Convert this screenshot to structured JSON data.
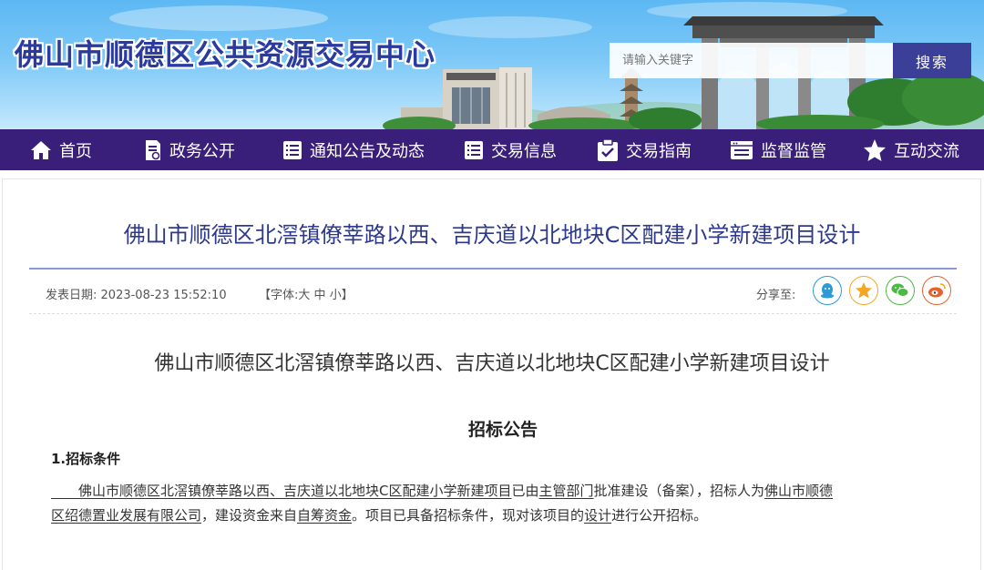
{
  "header": {
    "site_title": "佛山市顺德区公共资源交易中心",
    "search": {
      "placeholder": "请输入关键字",
      "button_label": "搜索"
    }
  },
  "nav": {
    "items": [
      {
        "label": "首页",
        "icon": "home-icon"
      },
      {
        "label": "政务公开",
        "icon": "document-icon"
      },
      {
        "label": "通知公告及动态",
        "icon": "checklist-icon"
      },
      {
        "label": "交易信息",
        "icon": "list-icon"
      },
      {
        "label": "交易指南",
        "icon": "clipboard-check-icon"
      },
      {
        "label": "监督监管",
        "icon": "monitor-icon"
      },
      {
        "label": "互动交流",
        "icon": "star-icon"
      }
    ]
  },
  "article": {
    "title": "佛山市顺德区北滘镇僚莘路以西、吉庆道以北地块C区配建小学新建项目设计",
    "meta": {
      "publish_label": "发表日期:",
      "publish_date": "2023-08-23 15:52:10",
      "font_prefix": "【字体:",
      "font_large": "大",
      "font_medium": "中",
      "font_small": "小",
      "font_suffix": "】",
      "share_label": "分享至:"
    },
    "share": [
      {
        "name": "qq-icon",
        "color": "#2e9ad8"
      },
      {
        "name": "qzone-icon",
        "color": "#f5a623"
      },
      {
        "name": "wechat-icon",
        "color": "#4cb944"
      },
      {
        "name": "weibo-icon",
        "color": "#e6612c"
      }
    ],
    "doc_title": "佛山市顺德区北滘镇僚莘路以西、吉庆道以北地块C区配建小学新建项目设计",
    "notice_heading": "招标公告",
    "section1_heading": "1.招标条件",
    "para": {
      "project_name": "佛山市顺德区北滘镇僚莘路以西、吉庆道以北地块C区配建小学新建项目",
      "t1": "已由",
      "authority": "主管部门",
      "t2": "批准建设（备案），招标人为",
      "tenderer_part1": "佛山市顺德",
      "tenderer_part2": "区绍德置业发展有限公司",
      "t3": "，建设资金来自",
      "funding": "自筹资金",
      "t4": "。项目已具备招标条件，现对该项目的",
      "scope": "设计",
      "t5": "进行公开招标。"
    }
  },
  "colors": {
    "nav_bg": "#3a1f7a",
    "title_blue": "#2d3a8c",
    "search_button": "#3b3f98"
  }
}
